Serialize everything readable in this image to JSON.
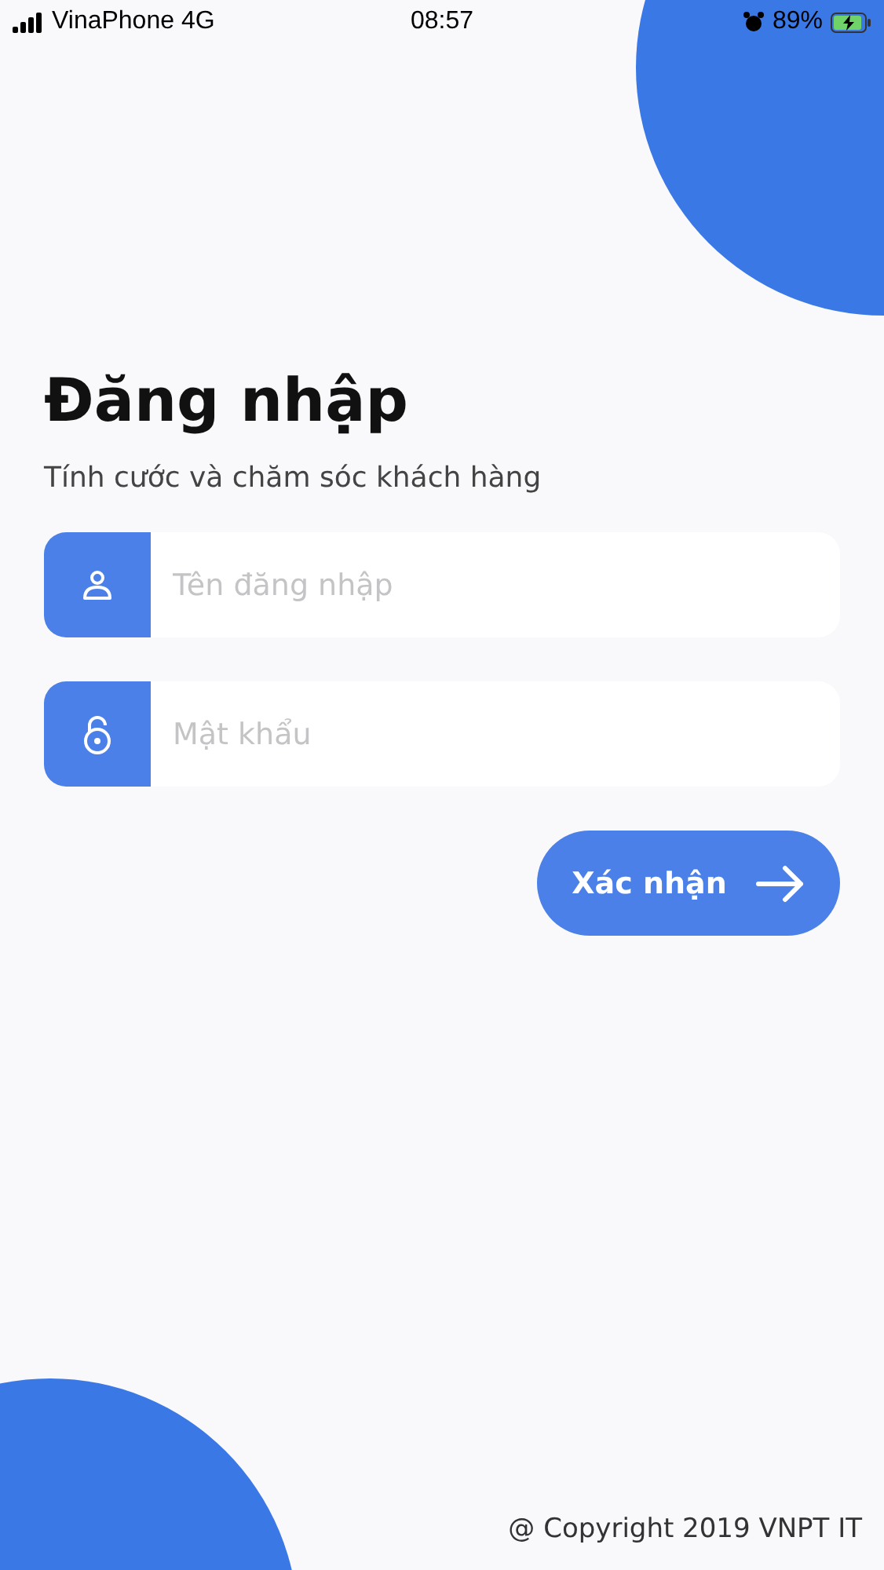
{
  "status_bar": {
    "carrier": "VinaPhone 4G",
    "time": "08:57",
    "battery": "89%"
  },
  "title": "Đăng nhập",
  "subtitle": "Tính cước và chăm sóc khách hàng",
  "fields": [
    {
      "kind": "user",
      "placeholder": "Tên đăng nhập"
    },
    {
      "kind": "password",
      "placeholder": "Mật khẩu"
    }
  ],
  "submit": {
    "label": "Xác nhận"
  },
  "footer": "@ Copyright 2019 VNPT IT"
}
